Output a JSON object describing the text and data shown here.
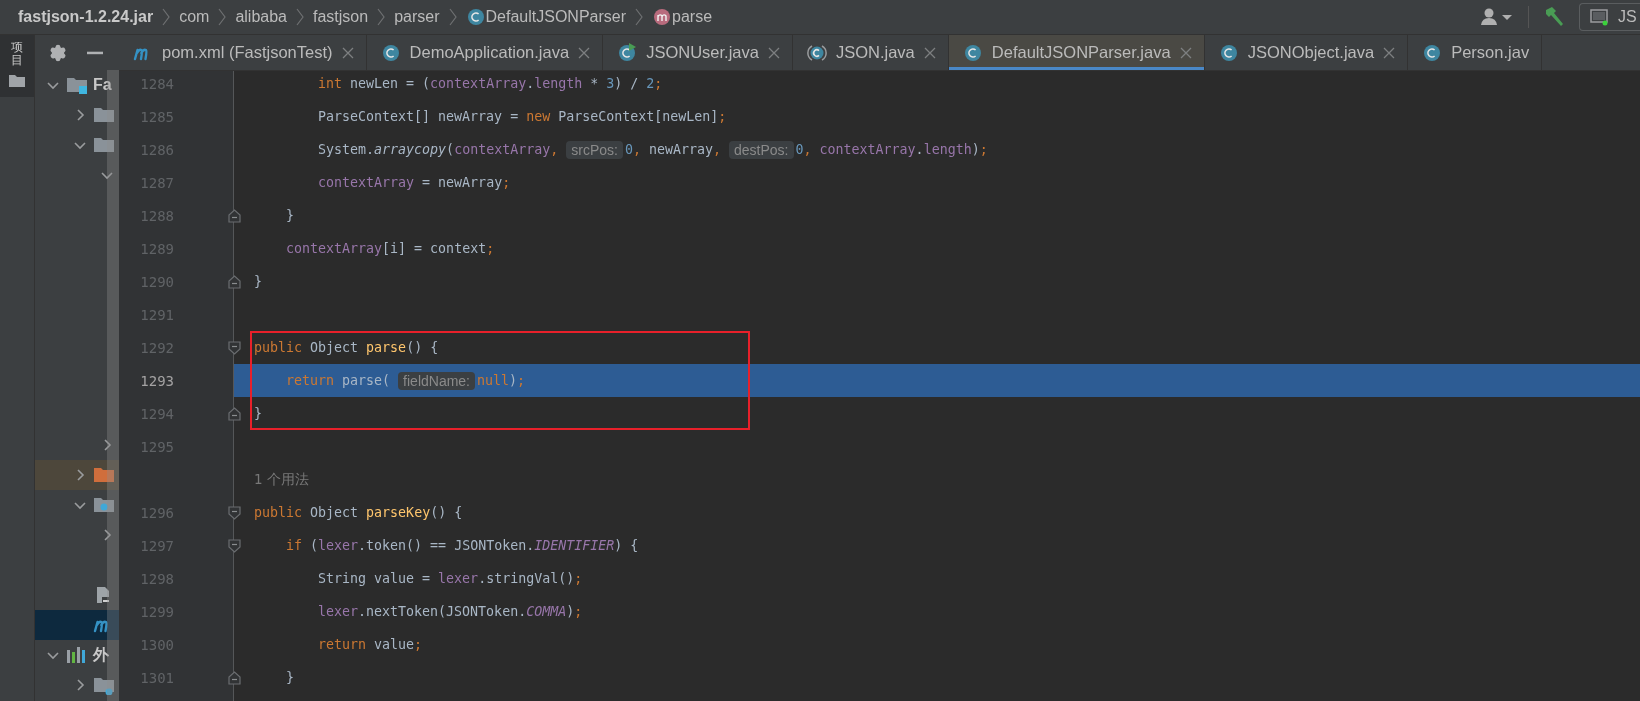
{
  "breadcrumbs": [
    {
      "label": "fastjson-1.2.24.jar",
      "bold": true
    },
    {
      "label": "com",
      "bold": false
    },
    {
      "label": "alibaba",
      "bold": false
    },
    {
      "label": "fastjson",
      "bold": false
    },
    {
      "label": "parser",
      "bold": false
    },
    {
      "label": "DefaultJSONParser",
      "bold": false,
      "kind": "class"
    },
    {
      "label": "parse",
      "bold": false,
      "kind": "method"
    }
  ],
  "toolbar": {
    "run_config": "JS"
  },
  "tool_stripe": [
    {
      "label": "项目",
      "selected": true
    }
  ],
  "project_tree": [
    {
      "label": "Fa",
      "kind": "module",
      "expanded": true,
      "selected": false,
      "children": [
        {
          "kind": "folder",
          "expanded": false,
          "selected": false
        },
        {
          "kind": "folder",
          "expanded": true,
          "selected": false,
          "children": [
            {
              "expanded": true,
              "selected": false
            },
            {
              "expanded": false,
              "selected": false
            }
          ]
        },
        {
          "kind": "folder_excluded",
          "expanded": false,
          "selected": false,
          "excluded": true
        },
        {
          "kind": "folder_source",
          "expanded": true,
          "selected": false,
          "children": [
            {
              "expanded": false,
              "selected": false
            }
          ]
        },
        {
          "kind": "file",
          "selected": false
        },
        {
          "kind": "maven",
          "selected": true
        }
      ]
    },
    {
      "label": "外",
      "kind": "library",
      "expanded": true,
      "selected": false,
      "children": [
        {
          "kind": "folder_lib",
          "expanded": false,
          "selected": false
        }
      ]
    }
  ],
  "tabs": [
    {
      "label": "pom.xml (FastjsonTest)",
      "kind": "maven",
      "selected": false,
      "closable": true
    },
    {
      "label": "DemoApplication.java",
      "kind": "class",
      "selected": false,
      "closable": true
    },
    {
      "label": "JSONUser.java",
      "kind": "class_run",
      "selected": false,
      "closable": true
    },
    {
      "label": "JSON.java",
      "kind": "abstract_class",
      "selected": false,
      "closable": true
    },
    {
      "label": "DefaultJSONParser.java",
      "kind": "class",
      "selected": true,
      "closable": true
    },
    {
      "label": "JSONObject.java",
      "kind": "class",
      "selected": false,
      "closable": true
    },
    {
      "label": "Person.jav",
      "kind": "class",
      "selected": false,
      "closable": false
    }
  ],
  "editor": {
    "lines": [
      {
        "children": [
          {
            "children": [
              {
                "number": "1284",
                "tokens": [
                  {
                    "text": "int",
                    "kind": "kw"
                  },
                  {
                    "text": " newLen = (",
                    "kind": "plain"
                  },
                  {
                    "text": "contextArray",
                    "kind": "field"
                  },
                  {
                    "text": ".",
                    "kind": "plain"
                  },
                  {
                    "text": "length",
                    "kind": "field"
                  },
                  {
                    "text": " * ",
                    "kind": "plain"
                  },
                  {
                    "text": "3",
                    "kind": "num"
                  },
                  {
                    "text": ") / ",
                    "kind": "plain"
                  },
                  {
                    "text": "2",
                    "kind": "num"
                  },
                  {
                    "text": ";",
                    "kind": "punct"
                  }
                ]
              },
              {
                "number": "1285",
                "tokens": [
                  {
                    "text": "ParseContext[] newArray = ",
                    "kind": "plain"
                  },
                  {
                    "text": "new",
                    "kind": "kw"
                  },
                  {
                    "text": " ParseContext[newLen]",
                    "kind": "plain"
                  },
                  {
                    "text": ";",
                    "kind": "punct"
                  }
                ]
              },
              {
                "number": "1286",
                "tokens": [
                  {
                    "text": "System.",
                    "kind": "plain"
                  },
                  {
                    "text": "arraycopy",
                    "kind": "static"
                  },
                  {
                    "text": "(",
                    "kind": "plain"
                  },
                  {
                    "text": "contextArray",
                    "kind": "field"
                  },
                  {
                    "text": ",",
                    "kind": "punct"
                  },
                  {
                    "text": "srcPos:",
                    "kind": "hint"
                  },
                  {
                    "text": "0",
                    "kind": "num"
                  },
                  {
                    "text": ",",
                    "kind": "punct"
                  },
                  {
                    "text": " newArray",
                    "kind": "plain"
                  },
                  {
                    "text": ",",
                    "kind": "punct"
                  },
                  {
                    "text": "destPos:",
                    "kind": "hint"
                  },
                  {
                    "text": "0",
                    "kind": "num"
                  },
                  {
                    "text": ",",
                    "kind": "punct"
                  },
                  {
                    "text": " contextArray",
                    "kind": "field"
                  },
                  {
                    "text": ".",
                    "kind": "plain"
                  },
                  {
                    "text": "length",
                    "kind": "field"
                  },
                  {
                    "text": ")",
                    "kind": "plain"
                  },
                  {
                    "text": ";",
                    "kind": "punct"
                  }
                ]
              },
              {
                "number": "1287",
                "tokens": [
                  {
                    "text": "contextArray",
                    "kind": "field"
                  },
                  {
                    "text": " = newArray",
                    "kind": "plain"
                  },
                  {
                    "text": ";",
                    "kind": "punct"
                  }
                ]
              }
            ]
          },
          {
            "number": "1288",
            "fold_end": true,
            "tokens": [
              {
                "text": "}",
                "kind": "plain"
              }
            ]
          },
          {
            "number": "1289",
            "tokens": [
              {
                "text": "contextArray",
                "kind": "field"
              },
              {
                "text": "[i] = context",
                "kind": "plain"
              },
              {
                "text": ";",
                "kind": "punct"
              }
            ]
          }
        ]
      },
      {
        "number": "1290",
        "fold_end": true,
        "tokens": [
          {
            "text": "}",
            "kind": "plain"
          }
        ]
      },
      {
        "number": "1291"
      },
      {
        "number": "1292",
        "fold_start": true,
        "boxed": true,
        "tokens": [
          {
            "text": "public",
            "kind": "kw"
          },
          {
            "text": " Object ",
            "kind": "plain"
          },
          {
            "text": "parse",
            "kind": "method"
          },
          {
            "text": "() {",
            "kind": "plain"
          }
        ],
        "children": [
          {
            "number": "1293",
            "current": true,
            "boxed": true,
            "tokens": [
              {
                "text": "return",
                "kind": "kw"
              },
              {
                "text": " parse(",
                "kind": "plain"
              },
              {
                "text": "fieldName:",
                "kind": "hint"
              },
              {
                "text": "null",
                "kind": "kw"
              },
              {
                "text": ")",
                "kind": "plain"
              },
              {
                "text": ";",
                "kind": "punct"
              }
            ]
          }
        ]
      },
      {
        "number": "1294",
        "fold_end": true,
        "boxed": true,
        "tokens": [
          {
            "text": "}",
            "kind": "plain"
          }
        ]
      },
      {
        "number": "1295"
      },
      {
        "kind": "usages",
        "text": "1 个用法"
      },
      {
        "number": "1296",
        "fold_start": true,
        "tokens": [
          {
            "text": "public",
            "kind": "kw"
          },
          {
            "text": " Object ",
            "kind": "plain"
          },
          {
            "text": "parseKey",
            "kind": "method"
          },
          {
            "text": "() {",
            "kind": "plain"
          }
        ],
        "children": [
          {
            "number": "1297",
            "fold_start": true,
            "tokens": [
              {
                "text": "if",
                "kind": "kw"
              },
              {
                "text": " (",
                "kind": "plain"
              },
              {
                "text": "lexer",
                "kind": "field"
              },
              {
                "text": ".token() == JSONToken.",
                "kind": "plain"
              },
              {
                "text": "IDENTIFIER",
                "kind": "const"
              },
              {
                "text": ") {",
                "kind": "plain"
              }
            ],
            "children": [
              {
                "number": "1298",
                "tokens": [
                  {
                    "text": "String value = ",
                    "kind": "plain"
                  },
                  {
                    "text": "lexer",
                    "kind": "field"
                  },
                  {
                    "text": ".stringVal()",
                    "kind": "plain"
                  },
                  {
                    "text": ";",
                    "kind": "punct"
                  }
                ]
              },
              {
                "number": "1299",
                "tokens": [
                  {
                    "text": "lexer",
                    "kind": "field"
                  },
                  {
                    "text": ".nextToken(JSONToken.",
                    "kind": "plain"
                  },
                  {
                    "text": "COMMA",
                    "kind": "const"
                  },
                  {
                    "text": ")",
                    "kind": "plain"
                  },
                  {
                    "text": ";",
                    "kind": "punct"
                  }
                ]
              },
              {
                "number": "1300",
                "tokens": [
                  {
                    "text": "return",
                    "kind": "kw"
                  },
                  {
                    "text": " value",
                    "kind": "plain"
                  },
                  {
                    "text": ";",
                    "kind": "punct"
                  }
                ]
              }
            ]
          },
          {
            "number": "1301",
            "fold_end": true,
            "tokens": [
              {
                "text": "}",
                "kind": "plain"
              }
            ]
          }
        ]
      }
    ]
  }
}
